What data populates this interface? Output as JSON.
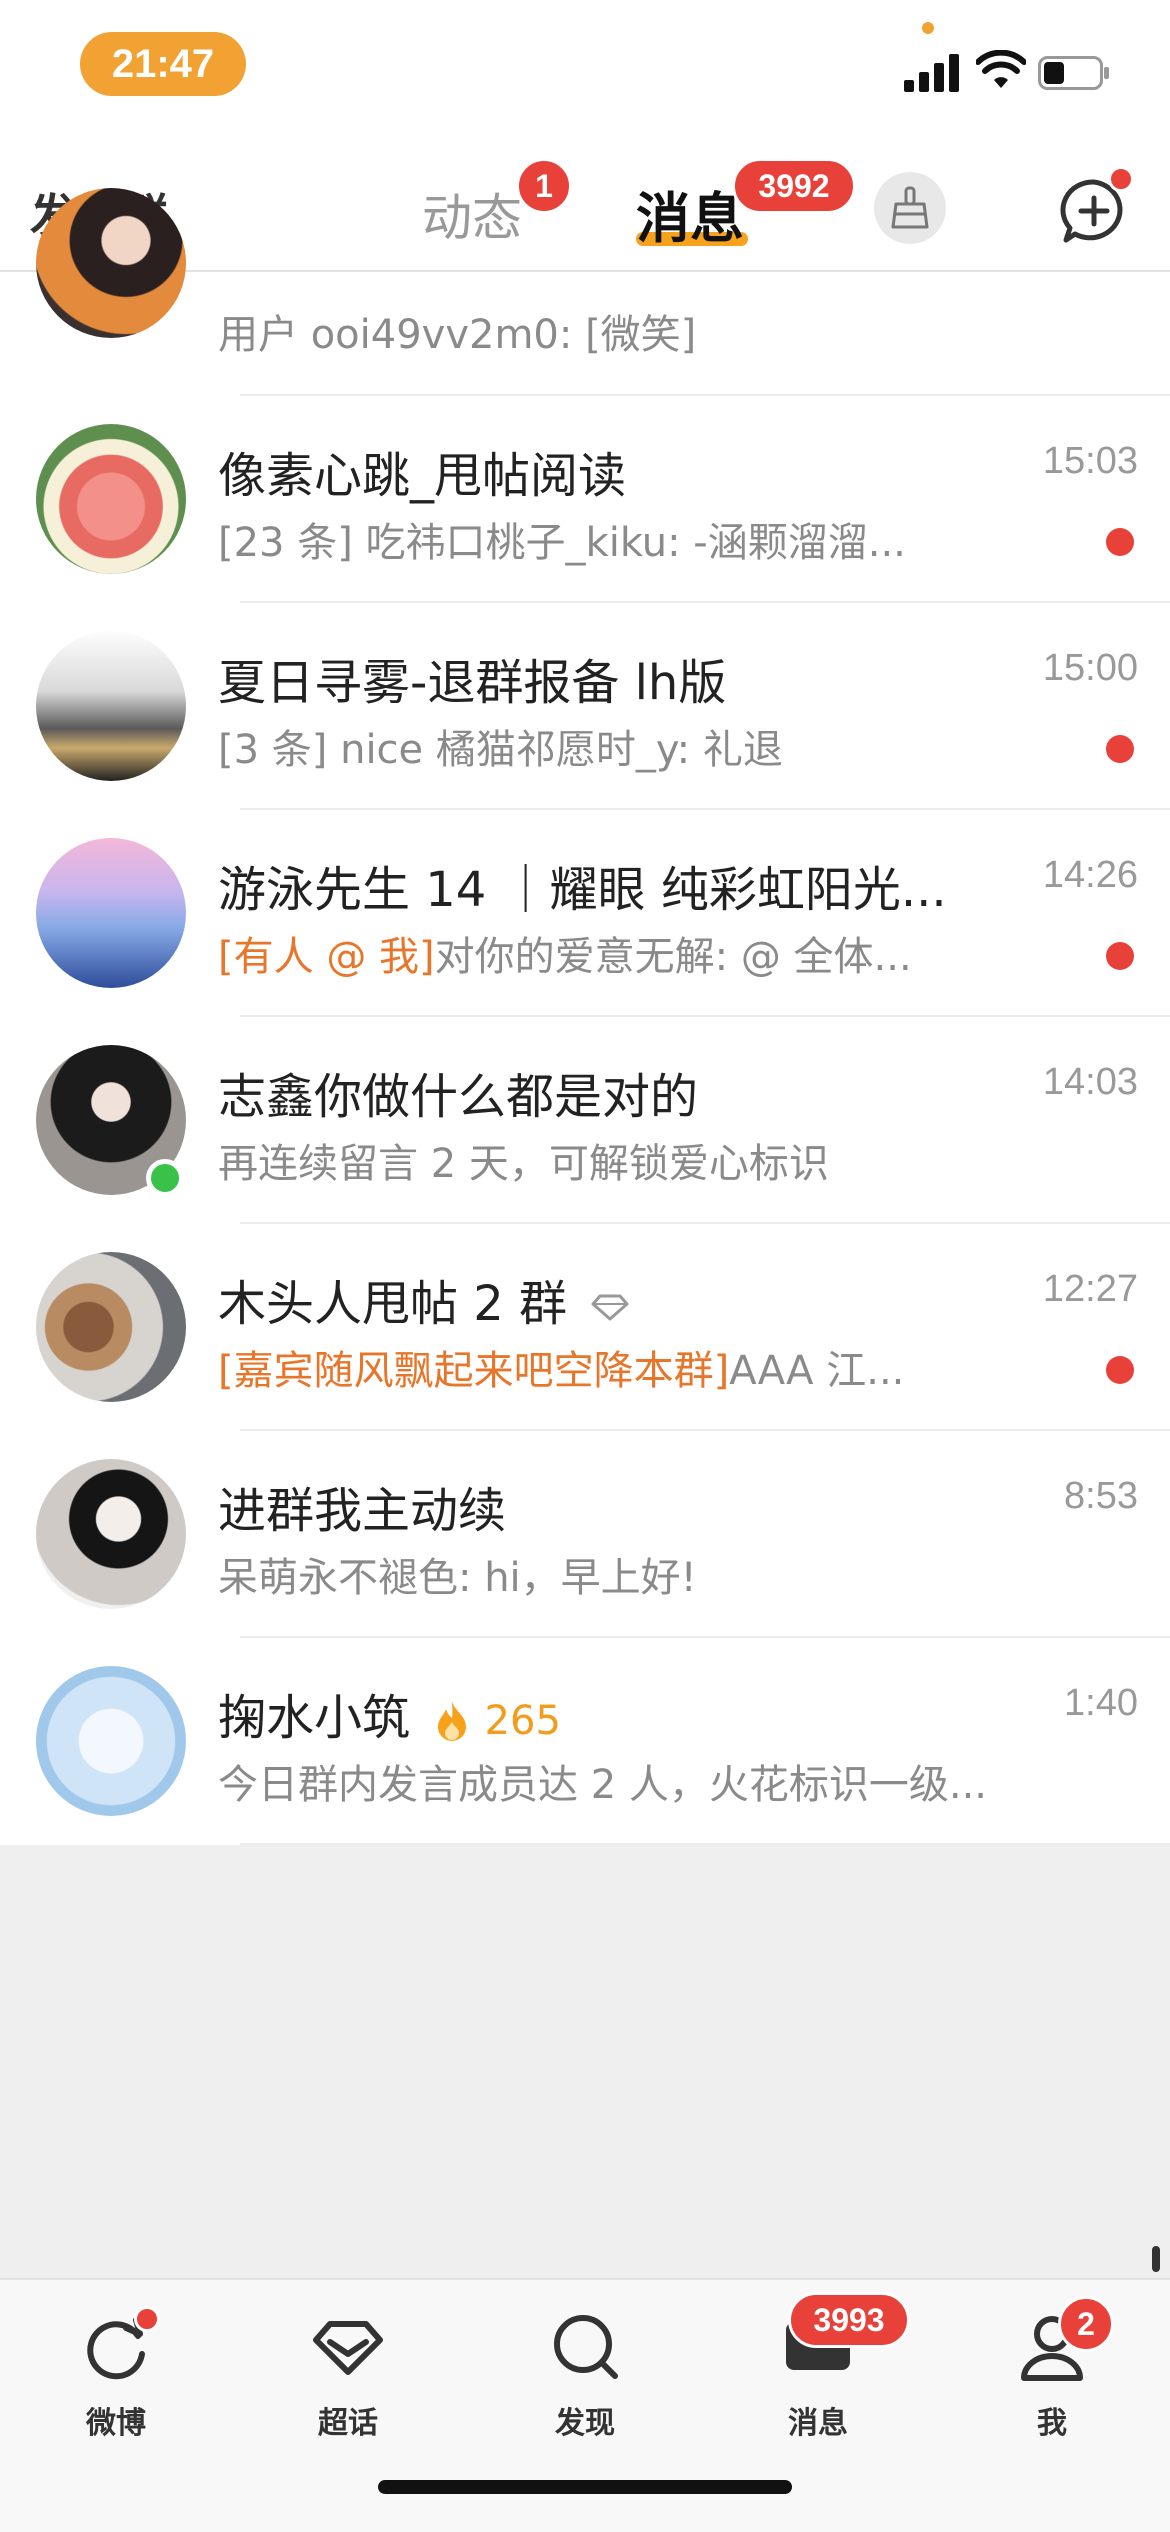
{
  "status": {
    "time": "21:47"
  },
  "header": {
    "left_title": "发现群",
    "tab_dynamic": "动态",
    "tab_dynamic_badge": "1",
    "tab_messages": "消息",
    "tab_messages_badge": "3992"
  },
  "list": {
    "items": [
      {
        "title": "",
        "subtitle": "用户 ooi49vv2m0: [微笑]",
        "time": "",
        "unread": false
      },
      {
        "title": "像素心跳_甩帖阅读",
        "subtitle": "[23 条] 吃祎口桃子_kiku: -涵颗溜溜...",
        "time": "15:03",
        "unread": true
      },
      {
        "title": "夏日寻雾-退群报备 lh版",
        "subtitle": "[3 条] nice 橘猫祁愿时_y: 礼退",
        "time": "15:00",
        "unread": true
      },
      {
        "title": "游泳先生 14 ｜耀眼 纯彩虹阳光...",
        "mention": "[有人 @ 我]",
        "subtitle": "对你的爱意无解: @ 全体...",
        "time": "14:26",
        "unread": true
      },
      {
        "title": "志鑫你做什么都是对的",
        "subtitle": "再连续留言 2 天，可解锁爱心标识",
        "time": "14:03",
        "unread": false
      },
      {
        "title": "木头人甩帖 2 群",
        "mention": "[嘉宾随风飘起来吧空降本群]",
        "subtitle": "AAA 江...",
        "time": "12:27",
        "unread": true
      },
      {
        "title": "进群我主动续",
        "subtitle": "呆萌永不褪色: hi，早上好!",
        "time": "8:53",
        "unread": false
      },
      {
        "title": "掬水小筑",
        "fire": "265",
        "subtitle": "今日群内发言成员达 2 人，火花标识一级...",
        "time": "1:40",
        "unread": false
      }
    ]
  },
  "tabbar": {
    "weibo": "微博",
    "chaohua": "超话",
    "discover": "发现",
    "messages": "消息",
    "messages_badge": "3993",
    "me": "我",
    "me_badge": "2"
  },
  "colors": {
    "accent": "#f7a21b",
    "badge": "#e8413a",
    "mention": "#e8762a"
  }
}
